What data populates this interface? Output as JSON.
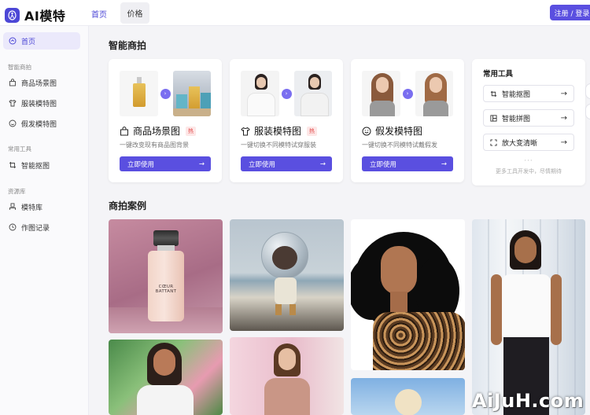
{
  "header": {
    "logo_text": "AI模特",
    "nav": [
      {
        "label": "首页",
        "active": true
      },
      {
        "label": "价格",
        "active": false
      }
    ],
    "login_label": "注册 / 登录",
    "accent_color": "#5a4fe0"
  },
  "sidebar": {
    "home": {
      "label": "首页",
      "icon": "home-icon"
    },
    "groups": [
      {
        "title": "智能商拍",
        "items": [
          {
            "label": "商品场景图",
            "icon": "bag-icon"
          },
          {
            "label": "服装模特图",
            "icon": "shirt-icon"
          },
          {
            "label": "假发模特图",
            "icon": "smile-icon"
          }
        ]
      },
      {
        "title": "常用工具",
        "items": [
          {
            "label": "智能抠图",
            "icon": "crop-icon"
          }
        ]
      },
      {
        "title": "资源库",
        "items": [
          {
            "label": "模特库",
            "icon": "model-icon"
          },
          {
            "label": "作图记录",
            "icon": "clock-icon"
          }
        ]
      }
    ]
  },
  "main": {
    "section1_title": "智能商拍",
    "section2_title": "商拍案例",
    "cards": [
      {
        "title": "商品场景图",
        "badge": "热",
        "desc": "一键改变现有商品图背景",
        "button": "立即使用",
        "icon": "bag-icon"
      },
      {
        "title": "服装模特图",
        "badge": "热",
        "desc": "一键切换不同模特试穿服装",
        "button": "立即使用",
        "icon": "shirt-icon"
      },
      {
        "title": "假发模特图",
        "badge": "",
        "desc": "一键切换不同模特试戴假发",
        "button": "立即使用",
        "icon": "smile-icon"
      }
    ],
    "tools": {
      "title": "常用工具",
      "items": [
        {
          "label": "智能抠图",
          "icon": "crop-icon"
        },
        {
          "label": "智能拼图",
          "icon": "layout-icon"
        },
        {
          "label": "放大变清晰",
          "icon": "expand-icon"
        }
      ],
      "ellipsis": "···",
      "more": "更多工具开发中，尽情期待"
    },
    "cases": [
      {
        "text": "CŒUR BATTANT"
      }
    ]
  },
  "watermark": "AiJuH.com"
}
